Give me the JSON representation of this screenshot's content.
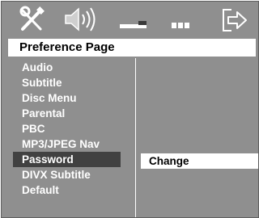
{
  "header": {
    "title": "Preference Page",
    "icons": [
      "general-setup-icon",
      "audio-setup-icon",
      "video-setup-icon",
      "preference-page-icon",
      "exit-setup-icon"
    ]
  },
  "menu": {
    "items": [
      {
        "label": "Audio"
      },
      {
        "label": "Subtitle"
      },
      {
        "label": "Disc Menu"
      },
      {
        "label": "Parental"
      },
      {
        "label": "PBC"
      },
      {
        "label": "MP3/JPEG Nav"
      },
      {
        "label": "Password"
      },
      {
        "label": "DIVX Subtitle"
      },
      {
        "label": "Default"
      }
    ],
    "selected": "Password"
  },
  "submenu": {
    "options": [
      {
        "label": "Change"
      }
    ]
  },
  "colors": {
    "background": "#8f8f8f",
    "selected_row": "#414141",
    "highlight": "#ffffff",
    "text": "#ffffff"
  }
}
